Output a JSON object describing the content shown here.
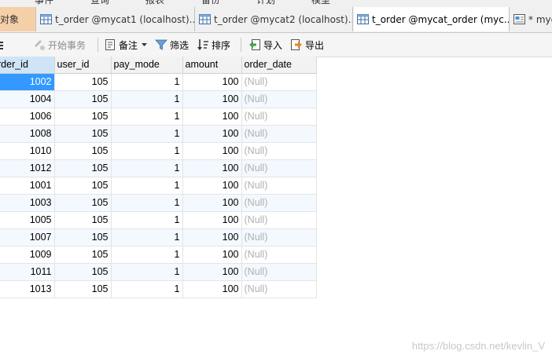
{
  "menu": [
    "事件",
    "查询",
    "报表",
    "备份",
    "计划",
    "模型"
  ],
  "tabs": [
    {
      "label": "对象",
      "kind": "objects"
    },
    {
      "label": "t_order @mycat1 (localhost)...",
      "kind": "table"
    },
    {
      "label": "t_order @mycat2 (localhost)...",
      "kind": "table"
    },
    {
      "label": "t_order @mycat_order (myc...",
      "kind": "table",
      "active": true
    },
    {
      "label": "* myc",
      "kind": "query"
    }
  ],
  "toolbar": {
    "begin_txn": "开始事务",
    "memo": "备注",
    "filter": "筛选",
    "sort": "排序",
    "import": "导入",
    "export": "导出"
  },
  "grid": {
    "columns": [
      "rder_id",
      "user_id",
      "pay_mode",
      "amount",
      "order_date"
    ],
    "rows": [
      [
        "1002",
        "105",
        "1",
        "100",
        "(Null)"
      ],
      [
        "1004",
        "105",
        "1",
        "100",
        "(Null)"
      ],
      [
        "1006",
        "105",
        "1",
        "100",
        "(Null)"
      ],
      [
        "1008",
        "105",
        "1",
        "100",
        "(Null)"
      ],
      [
        "1010",
        "105",
        "1",
        "100",
        "(Null)"
      ],
      [
        "1012",
        "105",
        "1",
        "100",
        "(Null)"
      ],
      [
        "1001",
        "105",
        "1",
        "100",
        "(Null)"
      ],
      [
        "1003",
        "105",
        "1",
        "100",
        "(Null)"
      ],
      [
        "1005",
        "105",
        "1",
        "100",
        "(Null)"
      ],
      [
        "1007",
        "105",
        "1",
        "100",
        "(Null)"
      ],
      [
        "1009",
        "105",
        "1",
        "100",
        "(Null)"
      ],
      [
        "1011",
        "105",
        "1",
        "100",
        "(Null)"
      ],
      [
        "1013",
        "105",
        "1",
        "100",
        "(Null)"
      ]
    ]
  },
  "watermark": "https://blog.csdn.net/kevlin_V",
  "colors": {
    "selection": "#3399ff",
    "objects_tab": "#f5cfa8",
    "header_selected": "#cfe4f7"
  }
}
